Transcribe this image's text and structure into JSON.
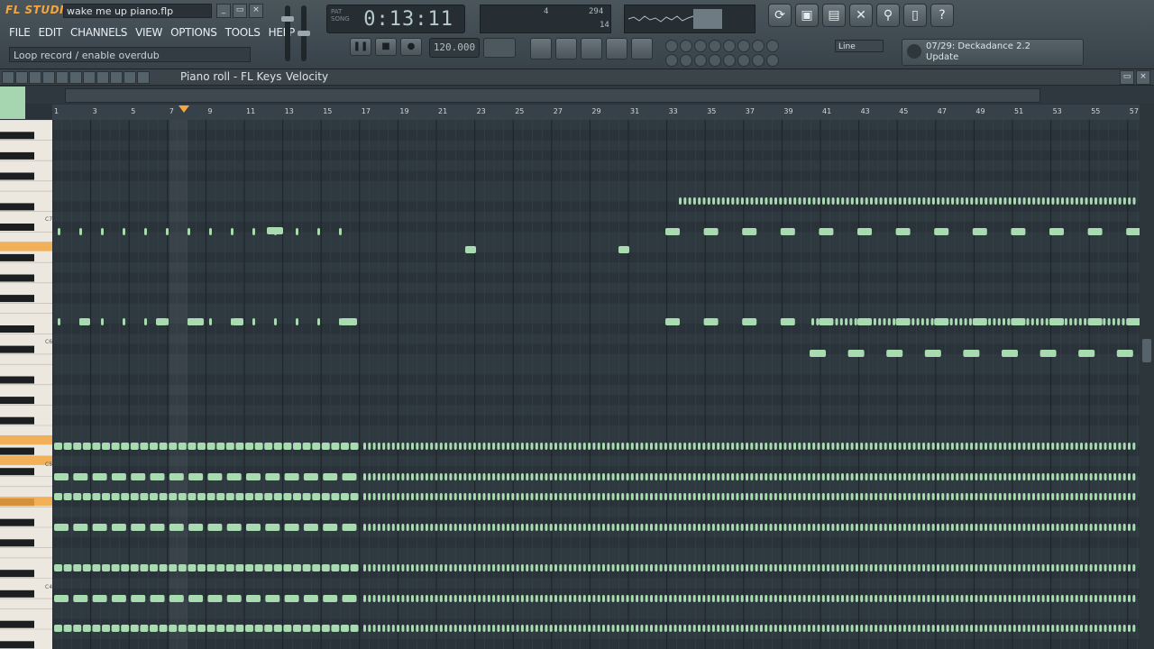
{
  "app": {
    "logo": "FL STUDIO",
    "filename": "wake me up piano.flp",
    "win_buttons": [
      "_",
      "▭",
      "×"
    ]
  },
  "menu": [
    "FILE",
    "EDIT",
    "CHANNELS",
    "VIEW",
    "OPTIONS",
    "TOOLS",
    "HELP"
  ],
  "hint": "Loop record / enable overdub",
  "time": "0:13:11",
  "time_labels": [
    "PAT",
    "SONG"
  ],
  "tempo": "120.000",
  "cpu": {
    "top_left": "4",
    "top_right": "294",
    "bottom": "14"
  },
  "snap": "Line",
  "plugin": {
    "line1": "07/29: Deckadance 2.2",
    "line2": "Update"
  },
  "pianoroll": {
    "title": "Piano roll - FL Keys",
    "target": "Velocity"
  },
  "ruler_ticks": [
    "1",
    "3",
    "5",
    "7",
    "9",
    "11",
    "13",
    "15",
    "17",
    "19",
    "21",
    "23",
    "25",
    "27",
    "29",
    "31",
    "33",
    "35",
    "37",
    "39",
    "41",
    "43",
    "45",
    "47",
    "49",
    "51",
    "53",
    "55",
    "57"
  ],
  "octave_labels": [
    "C7",
    "C6",
    "C5",
    "C4"
  ],
  "colors": {
    "note": "#a8dcb0",
    "accent": "#f3a640",
    "grid_bg": "#2f3940"
  }
}
